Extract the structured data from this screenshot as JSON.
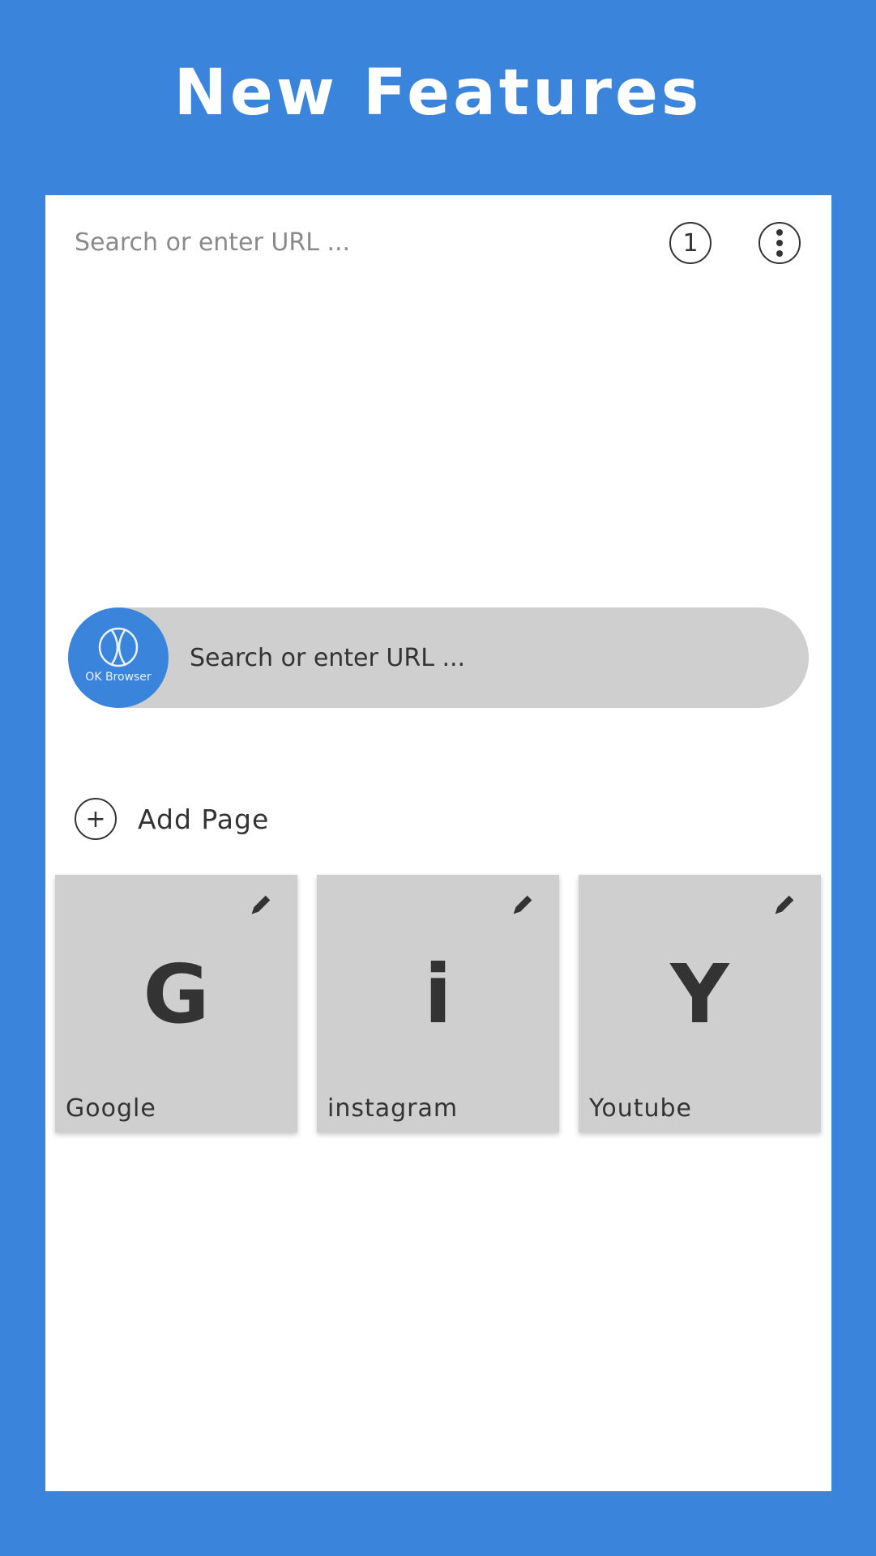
{
  "header": {
    "title": "New Features"
  },
  "browser": {
    "topbar": {
      "search_placeholder": "Search or enter URL ...",
      "tab_count": "1",
      "menu_icon": "more-vertical-icon"
    },
    "search": {
      "logo_label": "OK Browser",
      "placeholder": "Search or enter URL ..."
    },
    "add_page": {
      "label": "Add Page",
      "icon": "plus-circle-icon"
    },
    "tiles": [
      {
        "letter": "G",
        "name": "Google",
        "icon": "pencil-icon"
      },
      {
        "letter": "i",
        "name": "instagram",
        "icon": "pencil-icon"
      },
      {
        "letter": "Y",
        "name": "Youtube",
        "icon": "pencil-icon"
      }
    ]
  },
  "colors": {
    "accent": "#3b84dc",
    "surface": "#ffffff",
    "tile": "#cfcfcf",
    "text": "#333333"
  }
}
